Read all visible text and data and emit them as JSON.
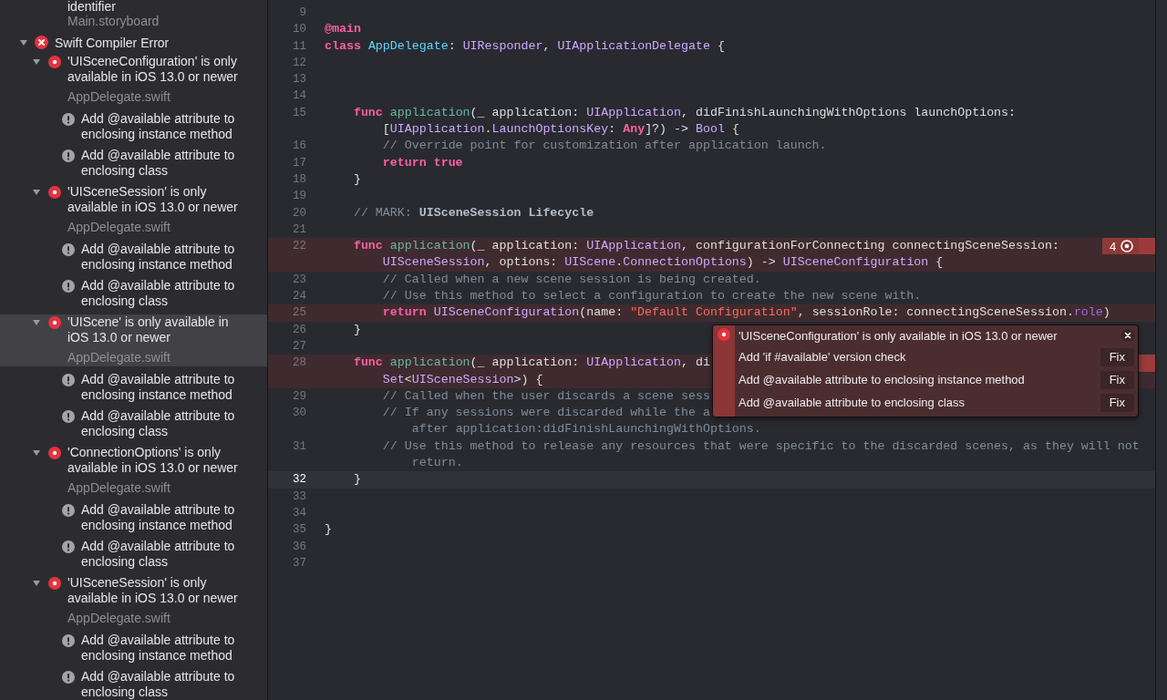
{
  "navigator": {
    "items": [
      {
        "kind": "label",
        "text": "identifier"
      },
      {
        "kind": "file",
        "text": "Main.storyboard"
      }
    ],
    "groups": [
      {
        "title": "Swift Compiler Error",
        "expanded": true,
        "issues": [
          {
            "message": "'UISceneConfiguration' is only available in iOS 13.0 or newer",
            "file": "AppDelegate.swift",
            "expanded": true,
            "selected": false,
            "fixes": [
              "Add @available attribute to enclosing instance method",
              "Add @available attribute to enclosing class"
            ]
          },
          {
            "message": "'UISceneSession' is only available in iOS 13.0 or newer",
            "file": "AppDelegate.swift",
            "expanded": true,
            "selected": false,
            "fixes": [
              "Add @available attribute to enclosing instance method",
              "Add @available attribute to enclosing class"
            ]
          },
          {
            "message": "'UIScene' is only available in iOS 13.0 or newer",
            "file": "AppDelegate.swift",
            "expanded": true,
            "selected": true,
            "fixes": [
              "Add @available attribute to enclosing instance method",
              "Add @available attribute to enclosing class"
            ]
          },
          {
            "message": "'ConnectionOptions' is only available in iOS 13.0 or newer",
            "file": "AppDelegate.swift",
            "expanded": true,
            "selected": false,
            "fixes": [
              "Add @available attribute to enclosing instance method",
              "Add @available attribute to enclosing class"
            ]
          },
          {
            "message": "'UISceneSession' is only available in iOS 13.0 or newer",
            "file": "AppDelegate.swift",
            "expanded": true,
            "selected": false,
            "fixes": [
              "Add @available attribute to enclosing instance method",
              "Add @available attribute to enclosing class"
            ]
          }
        ]
      }
    ]
  },
  "editor": {
    "lines": [
      {
        "number": "9",
        "error": false,
        "current": false,
        "marker": false
      },
      {
        "number": "10",
        "error": false,
        "current": false,
        "marker": false,
        "rows": [
          {
            "tokens": [
              {
                "kind": "attribute",
                "text": "@main"
              }
            ]
          }
        ]
      },
      {
        "number": "11",
        "error": false,
        "current": false,
        "marker": false,
        "rows": [
          {
            "tokens": [
              {
                "kind": "keyword",
                "text": "class "
              },
              {
                "kind": "declaration",
                "text": "AppDelegate"
              },
              {
                "kind": "plain",
                "text": ": "
              },
              {
                "kind": "type",
                "text": "UIResponder"
              },
              {
                "kind": "plain",
                "text": ", "
              },
              {
                "kind": "type",
                "text": "UIApplicationDelegate"
              },
              {
                "kind": "plain",
                "text": " {"
              }
            ]
          }
        ]
      },
      {
        "number": "12",
        "error": false,
        "current": false,
        "marker": false
      },
      {
        "number": "13",
        "error": false,
        "current": false,
        "marker": false
      },
      {
        "number": "14",
        "error": false,
        "current": false,
        "marker": false
      },
      {
        "number": "15",
        "error": false,
        "current": false,
        "marker": false,
        "rows": [
          {
            "tokens": [
              {
                "kind": "keyword",
                "text": "    func "
              },
              {
                "kind": "function",
                "text": "application"
              },
              {
                "kind": "plain",
                "text": "(_ application: "
              },
              {
                "kind": "type",
                "text": "UIApplication"
              },
              {
                "kind": "plain",
                "text": ", didFinishLaunchingWithOptions launchOptions:"
              }
            ]
          },
          {
            "tokens": [
              {
                "kind": "plain",
                "text": "        ["
              },
              {
                "kind": "type",
                "text": "UIApplication"
              },
              {
                "kind": "plain",
                "text": "."
              },
              {
                "kind": "type",
                "text": "LaunchOptionsKey"
              },
              {
                "kind": "plain",
                "text": ": "
              },
              {
                "kind": "keyword",
                "text": "Any"
              },
              {
                "kind": "plain",
                "text": "]?) -> "
              },
              {
                "kind": "type",
                "text": "Bool"
              },
              {
                "kind": "plain",
                "text": " {"
              }
            ]
          }
        ]
      },
      {
        "number": "16",
        "error": false,
        "current": false,
        "marker": false,
        "rows": [
          {
            "tokens": [
              {
                "kind": "comment",
                "text": "        // Override point for customization after application launch."
              }
            ]
          }
        ]
      },
      {
        "number": "17",
        "error": false,
        "current": false,
        "marker": false,
        "rows": [
          {
            "tokens": [
              {
                "kind": "keyword",
                "text": "        return true"
              }
            ]
          }
        ]
      },
      {
        "number": "18",
        "error": false,
        "current": false,
        "marker": false,
        "rows": [
          {
            "tokens": [
              {
                "kind": "plain",
                "text": "    }"
              }
            ]
          }
        ]
      },
      {
        "number": "19",
        "error": false,
        "current": false,
        "marker": false
      },
      {
        "number": "20",
        "error": false,
        "current": false,
        "marker": false,
        "rows": [
          {
            "tokens": [
              {
                "kind": "comment",
                "text": "    // MARK: "
              },
              {
                "kind": "mark",
                "text": "UISceneSession Lifecycle"
              }
            ]
          }
        ]
      },
      {
        "number": "21",
        "error": false,
        "current": false,
        "marker": false
      },
      {
        "number": "22",
        "error": true,
        "current": false,
        "marker": true,
        "badge": "4",
        "rows": [
          {
            "tokens": [
              {
                "kind": "keyword",
                "text": "    func "
              },
              {
                "kind": "function",
                "text": "application"
              },
              {
                "kind": "plain",
                "text": "(_ application: "
              },
              {
                "kind": "type",
                "text": "UIApplication"
              },
              {
                "kind": "plain",
                "text": ", configurationForConnecting connectingSceneSession:"
              }
            ]
          },
          {
            "tokens": [
              {
                "kind": "type",
                "text": "        UISceneSession"
              },
              {
                "kind": "plain",
                "text": ", options: "
              },
              {
                "kind": "type",
                "text": "UIScene"
              },
              {
                "kind": "plain",
                "text": "."
              },
              {
                "kind": "type",
                "text": "ConnectionOptions"
              },
              {
                "kind": "plain",
                "text": ") -> "
              },
              {
                "kind": "type",
                "text": "UISceneConfiguration"
              },
              {
                "kind": "plain",
                "text": " {"
              }
            ]
          }
        ]
      },
      {
        "number": "23",
        "error": false,
        "current": false,
        "marker": false,
        "rows": [
          {
            "tokens": [
              {
                "kind": "comment",
                "text": "        // Called when a new scene session is being created."
              }
            ]
          }
        ]
      },
      {
        "number": "24",
        "error": false,
        "current": false,
        "marker": false,
        "rows": [
          {
            "tokens": [
              {
                "kind": "comment",
                "text": "        // Use this method to select a configuration to create the new scene with."
              }
            ]
          }
        ]
      },
      {
        "number": "25",
        "error": true,
        "current": false,
        "marker": false,
        "rows": [
          {
            "tokens": [
              {
                "kind": "keyword",
                "text": "        return "
              },
              {
                "kind": "type",
                "text": "UISceneConfiguration"
              },
              {
                "kind": "plain",
                "text": "(name: "
              },
              {
                "kind": "string",
                "text": "\"Default Configuration\""
              },
              {
                "kind": "plain",
                "text": ", sessionRole: connectingSceneSession."
              },
              {
                "kind": "property",
                "text": "role"
              },
              {
                "kind": "plain",
                "text": ")"
              }
            ]
          }
        ]
      },
      {
        "number": "26",
        "error": false,
        "current": false,
        "marker": false,
        "rows": [
          {
            "tokens": [
              {
                "kind": "plain",
                "text": "    }"
              }
            ]
          }
        ]
      },
      {
        "number": "27",
        "error": false,
        "current": false,
        "marker": false
      },
      {
        "number": "28",
        "error": true,
        "current": false,
        "marker": true,
        "rows": [
          {
            "tokens": [
              {
                "kind": "keyword",
                "text": "    func "
              },
              {
                "kind": "function",
                "text": "application"
              },
              {
                "kind": "plain",
                "text": "(_ application: "
              },
              {
                "kind": "type",
                "text": "UIApplication"
              },
              {
                "kind": "plain",
                "text": ", di"
              }
            ]
          },
          {
            "tokens": [
              {
                "kind": "type",
                "text": "        Set"
              },
              {
                "kind": "plain",
                "text": "<"
              },
              {
                "kind": "type",
                "text": "UISceneSession"
              },
              {
                "kind": "plain",
                "text": ">) {"
              }
            ]
          }
        ]
      },
      {
        "number": "29",
        "error": false,
        "current": false,
        "marker": false,
        "rows": [
          {
            "tokens": [
              {
                "kind": "comment",
                "text": "        // Called when the user discards a scene sess"
              }
            ]
          }
        ]
      },
      {
        "number": "30",
        "error": false,
        "current": false,
        "marker": false,
        "rows": [
          {
            "tokens": [
              {
                "kind": "comment",
                "text": "        // If any sessions were discarded while the a"
              }
            ]
          },
          {
            "tokens": [
              {
                "kind": "comment",
                "text": "            after application:didFinishLaunchingWithOptions."
              }
            ]
          }
        ]
      },
      {
        "number": "31",
        "error": false,
        "current": false,
        "marker": false,
        "rows": [
          {
            "tokens": [
              {
                "kind": "comment",
                "text": "        // Use this method to release any resources that were specific to the discarded scenes, as they will not"
              }
            ]
          },
          {
            "tokens": [
              {
                "kind": "comment",
                "text": "            return."
              }
            ]
          }
        ]
      },
      {
        "number": "32",
        "error": false,
        "current": true,
        "marker": false,
        "rows": [
          {
            "tokens": [
              {
                "kind": "plain",
                "text": "    }"
              }
            ]
          }
        ]
      },
      {
        "number": "33",
        "error": false,
        "current": false,
        "marker": false
      },
      {
        "number": "34",
        "error": false,
        "current": false,
        "marker": false
      },
      {
        "number": "35",
        "error": false,
        "current": false,
        "marker": false,
        "rows": [
          {
            "tokens": [
              {
                "kind": "plain",
                "text": "}"
              }
            ]
          }
        ]
      },
      {
        "number": "36",
        "error": false,
        "current": false,
        "marker": false
      },
      {
        "number": "37",
        "error": false,
        "current": false,
        "marker": false
      }
    ],
    "popup": {
      "message": "'UISceneConfiguration' is only available in iOS 13.0 or newer",
      "fixes": [
        {
          "label": "Add 'if #available' version check",
          "button": "Fix"
        },
        {
          "label": "Add @available attribute to enclosing instance method",
          "button": "Fix"
        },
        {
          "label": "Add @available attribute to enclosing class",
          "button": "Fix"
        }
      ]
    }
  }
}
